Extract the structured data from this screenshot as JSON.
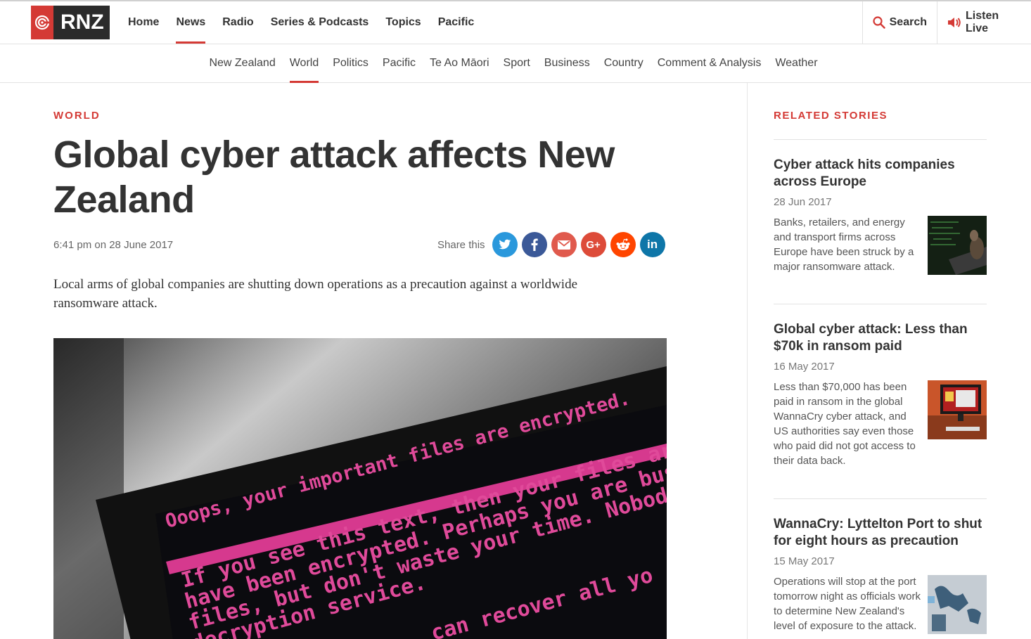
{
  "header": {
    "logo_text": "RNZ",
    "nav": [
      {
        "label": "Home"
      },
      {
        "label": "News"
      },
      {
        "label": "Radio"
      },
      {
        "label": "Series & Podcasts"
      },
      {
        "label": "Topics"
      },
      {
        "label": "Pacific"
      }
    ],
    "active_nav": "News",
    "search_label": "Search",
    "listen_label": "Listen Live"
  },
  "subnav": {
    "items": [
      {
        "label": "New Zealand"
      },
      {
        "label": "World"
      },
      {
        "label": "Politics"
      },
      {
        "label": "Pacific"
      },
      {
        "label": "Te Ao Māori"
      },
      {
        "label": "Sport"
      },
      {
        "label": "Business"
      },
      {
        "label": "Country"
      },
      {
        "label": "Comment & Analysis"
      },
      {
        "label": "Weather"
      }
    ],
    "active": "World"
  },
  "article": {
    "section": "WORLD",
    "headline": "Global cyber attack affects New Zealand",
    "dateline": "6:41 pm on 28 June 2017",
    "share_label": "Share this",
    "share_buttons": [
      {
        "icon": "twitter-icon",
        "color": "#2a98dc"
      },
      {
        "icon": "facebook-icon",
        "color": "#3b5998"
      },
      {
        "icon": "email-icon",
        "color": "#e05a4d"
      },
      {
        "icon": "google-plus-icon",
        "color": "#dd4b39"
      },
      {
        "icon": "reddit-icon",
        "color": "#ff4500"
      },
      {
        "icon": "linkedin-icon",
        "color": "#0e76a8"
      }
    ],
    "lead": "Local arms of global companies are shutting down operations as a precaution against a worldwide ransomware attack.",
    "hero_text_lines": [
      "Ooops, your important files are encrypted.",
      "If you see this text, then your files are",
      "have been encrypted. Perhaps you are busy",
      "files, but don't waste your time. Nobody",
      "decryption service.",
      "can recover all yo"
    ]
  },
  "sidebar": {
    "title": "RELATED STORIES",
    "stories": [
      {
        "title": "Cyber attack hits companies across Europe",
        "date": "28 Jun 2017",
        "body": "Banks, retailers, and energy and transport firms across Europe have been struck by a major ransomware attack."
      },
      {
        "title": "Global cyber attack: Less than $70k in ransom paid",
        "date": "16 May 2017",
        "body": "Less than $70,000 has been paid in ransom in the global WannaCry cyber attack, and US authorities say even those who paid did not got access to their data back."
      },
      {
        "title": "WannaCry: Lyttelton Port to shut for eight hours as precaution",
        "date": "15 May 2017",
        "body": "Operations will stop at the port tomorrow night as officials work to determine New Zealand's level of exposure to the attack."
      }
    ]
  },
  "colors": {
    "accent": "#d43a35",
    "text": "#333333"
  }
}
